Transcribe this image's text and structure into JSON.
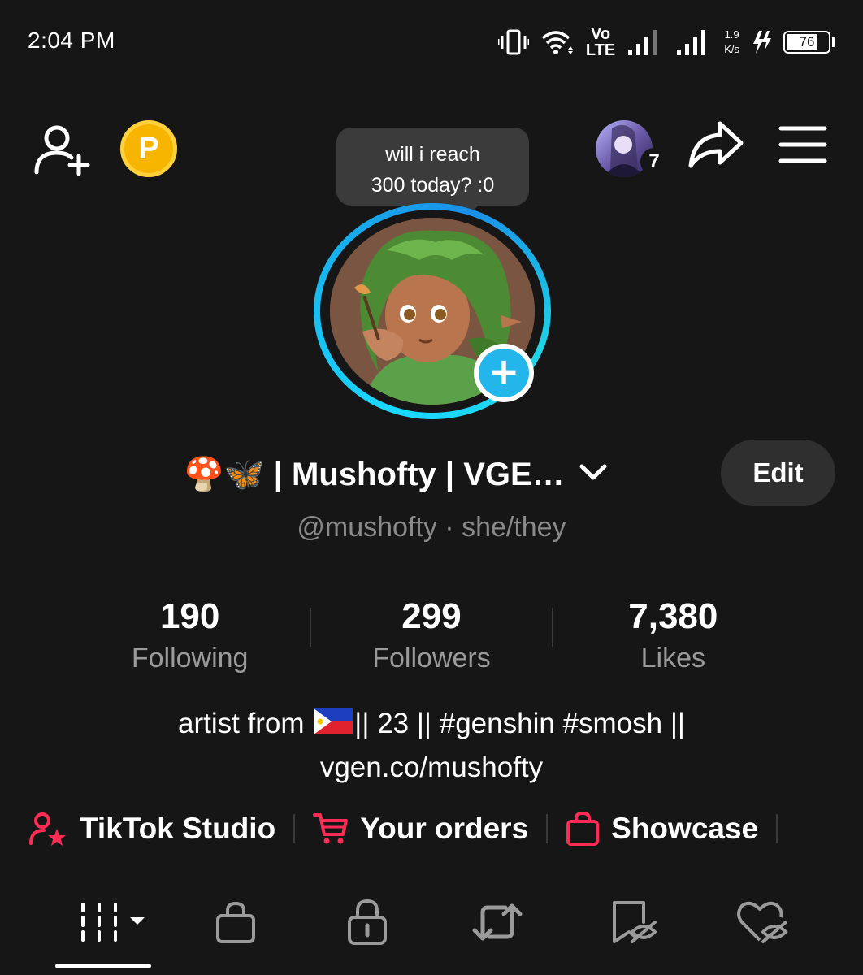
{
  "status_bar": {
    "time": "2:04 PM",
    "volte_top": "Vo",
    "volte_bottom": "LTE",
    "net_speed_value": "1.9",
    "net_speed_unit": "K/s",
    "battery_percent": "76"
  },
  "header": {
    "coin_label": "P",
    "note_line1": "will i reach",
    "note_line2": "300 today? :0",
    "story_count": "7"
  },
  "profile": {
    "display_name": "🍄🦋 | Mushofty | VGE…",
    "edit_label": "Edit",
    "handle_line": "@mushofty · she/they"
  },
  "stats": [
    {
      "value": "190",
      "label": "Following"
    },
    {
      "value": "299",
      "label": "Followers"
    },
    {
      "value": "7,380",
      "label": "Likes"
    }
  ],
  "bio": {
    "line1_before_flag": "artist from ",
    "line1_after_flag": "|| 23 || #genshin #smosh ||",
    "line2": "vgen.co/mushofty"
  },
  "quick_links": [
    {
      "label": "TikTok Studio",
      "icon": "user-star-icon"
    },
    {
      "label": "Your orders",
      "icon": "cart-icon"
    },
    {
      "label": "Showcase",
      "icon": "shopping-bag-icon"
    }
  ],
  "tabs": [
    "videos-grid-icon",
    "shop-bag-icon",
    "private-lock-icon",
    "repost-icon",
    "favorites-hidden-icon",
    "liked-hidden-icon"
  ],
  "colors": {
    "background": "#161616",
    "accent_red": "#fe2c55",
    "ring_cyan": "#1ad9ff",
    "coin_gold": "#f7b500"
  }
}
